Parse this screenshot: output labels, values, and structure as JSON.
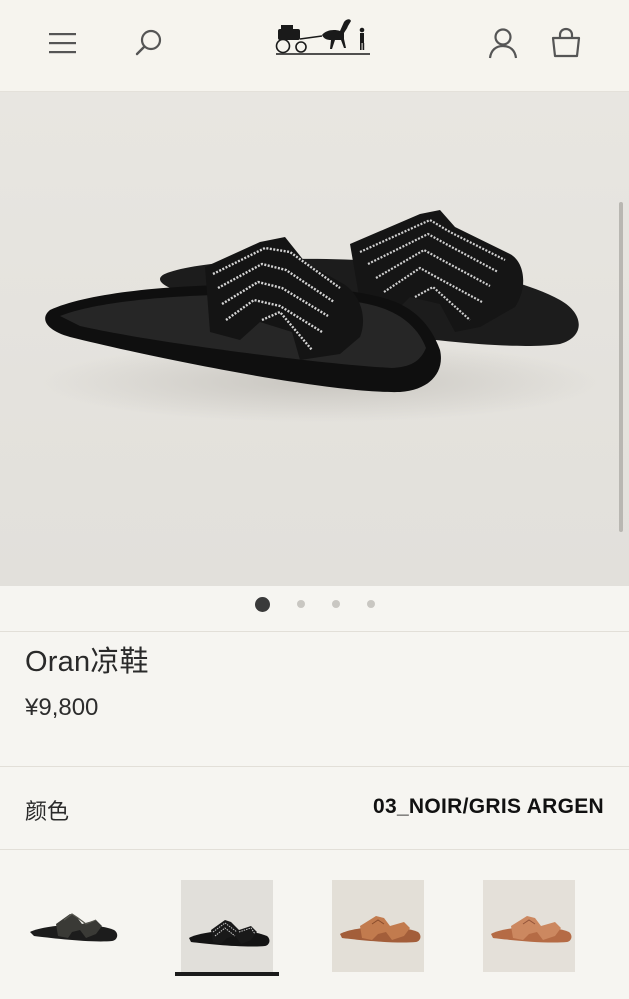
{
  "header": {
    "menu_icon": "hamburger-menu-icon",
    "search_icon": "search-icon",
    "logo": "carriage-logo",
    "account_icon": "account-icon",
    "bag_icon": "shopping-bag-icon"
  },
  "carousel": {
    "total_slides": 4,
    "active_slide": 1
  },
  "product": {
    "title": "Oran凉鞋",
    "price": "¥9,800"
  },
  "color": {
    "label": "颜色",
    "value": "03_NOIR/GRIS ARGEN"
  },
  "swatches": [
    {
      "tone": "black",
      "selected": false
    },
    {
      "tone": "black-crystal",
      "selected": true
    },
    {
      "tone": "tan",
      "selected": false
    },
    {
      "tone": "tan",
      "selected": false
    }
  ],
  "colors": {
    "background": "#f6f5f1",
    "hero_bg": "#e6e4df",
    "text": "#222222",
    "accent": "#1b1b1b"
  }
}
